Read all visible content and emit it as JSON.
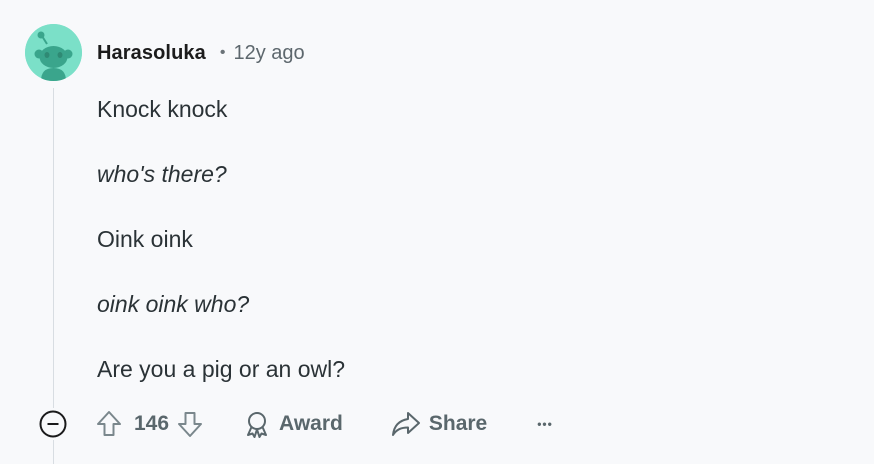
{
  "comment": {
    "author": "Harasoluka",
    "separator": "•",
    "age": "12y ago",
    "lines": [
      {
        "text": "Knock knock",
        "italic": false
      },
      {
        "text": "who's there?",
        "italic": true
      },
      {
        "text": "Oink oink",
        "italic": false
      },
      {
        "text": "oink oink who?",
        "italic": true
      },
      {
        "text": "Are you a pig or an owl?",
        "italic": false
      }
    ]
  },
  "actions": {
    "vote_count": "146",
    "award_label": "Award",
    "share_label": "Share",
    "more_label": "•••"
  },
  "icons": {
    "collapse": "minus-circle-icon",
    "upvote": "arrow-up-icon",
    "downvote": "arrow-down-icon",
    "award": "award-icon",
    "share": "share-arrow-icon",
    "more": "overflow-dots-icon"
  },
  "colors": {
    "avatar_bg": "#7be0c8",
    "avatar_fg": "#3aa58c",
    "meta_text": "#5d676d",
    "action_text": "#5a676c",
    "thread_line": "#d8dde2"
  }
}
